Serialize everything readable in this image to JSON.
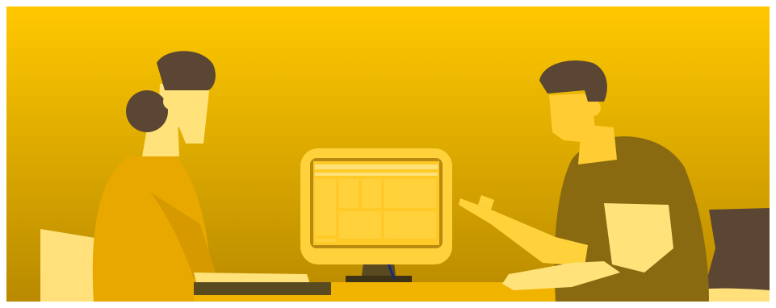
{
  "scene": {
    "description_name": "illustration",
    "colors": {
      "bg_top": "#FFC800",
      "bg_bottom": "#B98A00",
      "hair": "#5A4632",
      "skin": "#FFE27A",
      "shirt_left": "#E8A800",
      "shirt_right": "#8A6A10",
      "monitor_frame": "#FFD23C",
      "monitor_screen": "#FFCA28",
      "desk": "#F0B400",
      "desk_dark": "#5A4A20",
      "chair_left": "#FFE07A",
      "chair_right": "#5A4632"
    }
  }
}
